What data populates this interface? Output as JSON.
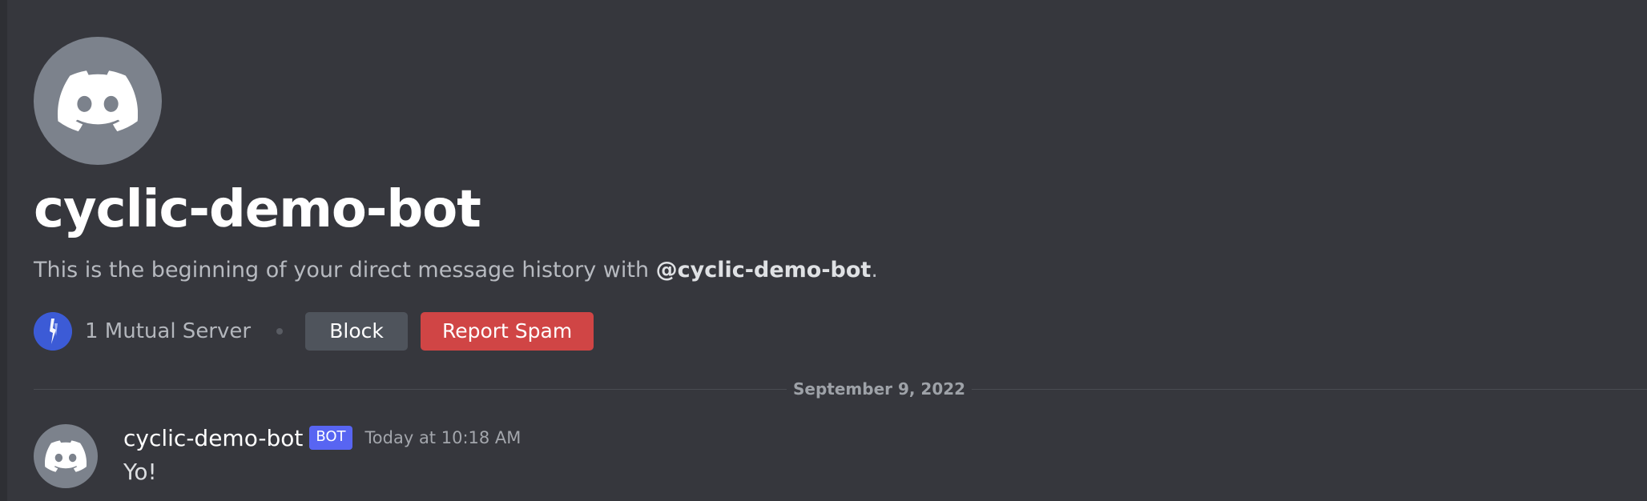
{
  "profile": {
    "username": "cyclic-demo-bot",
    "avatar_icon": "discord-logo-icon",
    "intro_prefix": "This is the beginning of your direct message history with ",
    "intro_mention": "@cyclic-demo-bot",
    "intro_suffix": "."
  },
  "actions": {
    "server_icon": "server-avatar-icon",
    "mutual_servers": "1 Mutual Server",
    "block_label": "Block",
    "report_spam_label": "Report Spam"
  },
  "divider": {
    "date": "September 9, 2022"
  },
  "messages": [
    {
      "author": "cyclic-demo-bot",
      "badge": "BOT",
      "timestamp": "Today at 10:18 AM",
      "text": "Yo!"
    }
  ],
  "colors": {
    "background": "#36373d",
    "avatar_bg": "#7c828c",
    "bot_badge": "#5865f2",
    "block_button": "#4f545c",
    "report_button": "#d04545",
    "server_icon_bg": "#3c5bd6"
  }
}
